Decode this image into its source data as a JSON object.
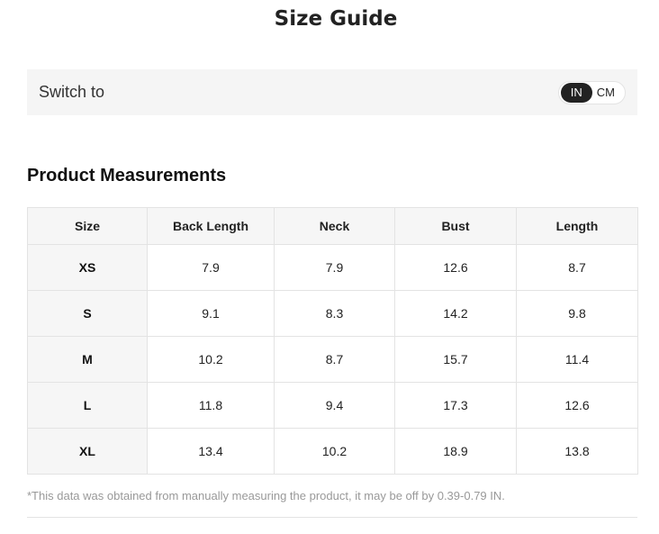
{
  "page": {
    "title": "Size Guide"
  },
  "unit_switch": {
    "label": "Switch to",
    "options": [
      "IN",
      "CM"
    ],
    "selected": "IN"
  },
  "section": {
    "title": "Product Measurements"
  },
  "table": {
    "headers": [
      "Size",
      "Back Length",
      "Neck",
      "Bust",
      "Length"
    ],
    "rows": [
      [
        "XS",
        "7.9",
        "7.9",
        "12.6",
        "8.7"
      ],
      [
        "S",
        "9.1",
        "8.3",
        "14.2",
        "9.8"
      ],
      [
        "M",
        "10.2",
        "8.7",
        "15.7",
        "11.4"
      ],
      [
        "L",
        "11.8",
        "9.4",
        "17.3",
        "12.6"
      ],
      [
        "XL",
        "13.4",
        "10.2",
        "18.9",
        "13.8"
      ]
    ]
  },
  "note": "*This data was obtained from manually measuring the product, it may be off by 0.39-0.79 IN."
}
